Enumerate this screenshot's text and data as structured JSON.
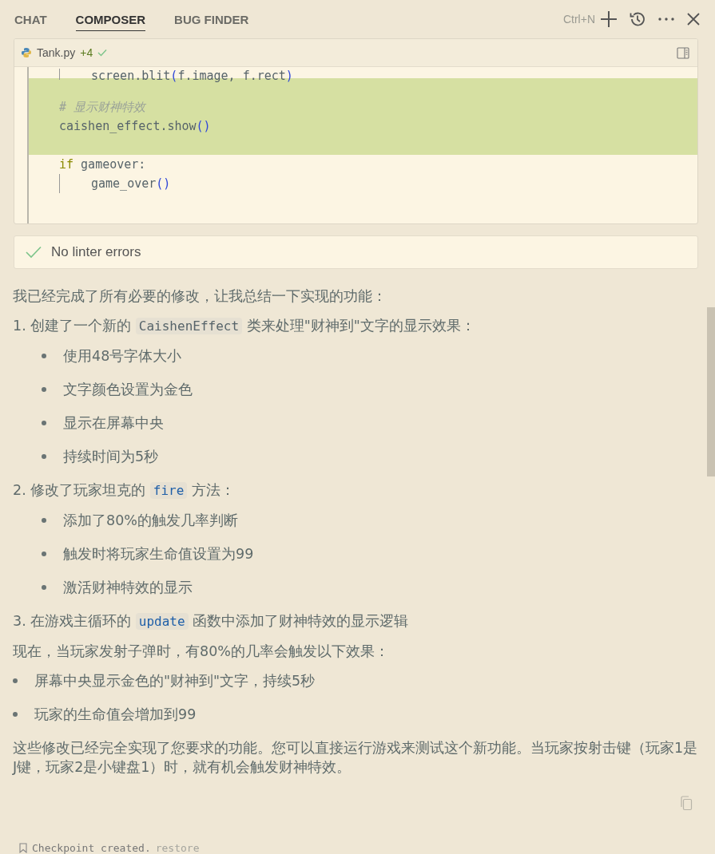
{
  "tabs": [
    {
      "label": "CHAT",
      "selected": false
    },
    {
      "label": "COMPOSER",
      "selected": true
    },
    {
      "label": "BUG FINDER",
      "selected": false
    }
  ],
  "toolbar": {
    "shortcut": "Ctrl+N"
  },
  "code_card": {
    "file_name": "Tank.py",
    "added_count": "+4",
    "applied": true,
    "lines": [
      {
        "added": false,
        "guide": true,
        "tokens": [
          {
            "text": "screen.blit",
            "kind": "plain"
          },
          {
            "text": "(",
            "kind": "paren"
          },
          {
            "text": "f.image, f.rect",
            "kind": "plain"
          },
          {
            "text": ")",
            "kind": "paren"
          }
        ]
      },
      {
        "added": true,
        "guide": false
      },
      {
        "added": true,
        "guide": false,
        "tokens": [
          {
            "text": "# 显示财神特效",
            "kind": "comment"
          }
        ]
      },
      {
        "added": true,
        "guide": false,
        "tokens": [
          {
            "text": "caishen_effect.show",
            "kind": "plain"
          },
          {
            "text": "()",
            "kind": "paren"
          }
        ]
      },
      {
        "added": true,
        "guide": false
      },
      {
        "added": false,
        "guide": false,
        "tokens": [
          {
            "text": "if",
            "kind": "keyword"
          },
          {
            "text": " gameover:",
            "kind": "plain"
          }
        ]
      },
      {
        "added": false,
        "guide": true,
        "tokens": [
          {
            "text": "game_over",
            "kind": "plain"
          },
          {
            "text": "()",
            "kind": "paren"
          }
        ]
      }
    ]
  },
  "linter": {
    "ok": true,
    "text": "No linter errors"
  },
  "message": [
    {
      "kind": "paragraph",
      "segments": [
        {
          "kind": "text",
          "text": "我已经完成了所有必要的修改，让我总结一下实现的功能："
        }
      ]
    },
    {
      "kind": "numbered",
      "segments": [
        {
          "kind": "text",
          "text": "1. 创建了一个新的 "
        },
        {
          "kind": "code",
          "text": "CaishenEffect"
        },
        {
          "kind": "text",
          "text": " 类来处理\"财神到\"文字的显示效果："
        }
      ]
    },
    {
      "kind": "subbullet",
      "segments": [
        {
          "kind": "text",
          "text": "使用48号字体大小"
        }
      ]
    },
    {
      "kind": "subbullet",
      "segments": [
        {
          "kind": "text",
          "text": "文字颜色设置为金色"
        }
      ]
    },
    {
      "kind": "subbullet",
      "segments": [
        {
          "kind": "text",
          "text": "显示在屏幕中央"
        }
      ]
    },
    {
      "kind": "subbullet",
      "segments": [
        {
          "kind": "text",
          "text": "持续时间为5秒"
        }
      ]
    },
    {
      "kind": "numbered",
      "segments": [
        {
          "kind": "text",
          "text": "2. 修改了玩家坦克的 "
        },
        {
          "kind": "code",
          "text": "fire"
        },
        {
          "kind": "text",
          "text": " 方法："
        }
      ]
    },
    {
      "kind": "subbullet",
      "segments": [
        {
          "kind": "text",
          "text": "添加了80%的触发几率判断"
        }
      ]
    },
    {
      "kind": "subbullet",
      "segments": [
        {
          "kind": "text",
          "text": "触发时将玩家生命值设置为99"
        }
      ]
    },
    {
      "kind": "subbullet",
      "segments": [
        {
          "kind": "text",
          "text": "激活财神特效的显示"
        }
      ]
    },
    {
      "kind": "numbered",
      "segments": [
        {
          "kind": "text",
          "text": "3. 在游戏主循环的 "
        },
        {
          "kind": "code",
          "text": "update"
        },
        {
          "kind": "text",
          "text": " 函数中添加了财神特效的显示逻辑"
        }
      ]
    },
    {
      "kind": "paragraph",
      "segments": [
        {
          "kind": "text",
          "text": "现在，当玩家发射子弹时，有80%的几率会触发以下效果："
        }
      ]
    },
    {
      "kind": "bullet",
      "segments": [
        {
          "kind": "text",
          "text": "屏幕中央显示金色的\"财神到\"文字，持续5秒"
        }
      ]
    },
    {
      "kind": "bullet",
      "segments": [
        {
          "kind": "text",
          "text": "玩家的生命值会增加到99"
        }
      ]
    },
    {
      "kind": "paragraph",
      "segments": [
        {
          "kind": "text",
          "text": "这些修改已经完全实现了您要求的功能。您可以直接运行游戏来测试这个新功能。当玩家按射击键（玩家1是J键，玩家2是小键盘1）时，就有机会触发财神特效。"
        }
      ]
    }
  ],
  "checkpoint": {
    "text": "Checkpoint created.",
    "link": "restore"
  }
}
